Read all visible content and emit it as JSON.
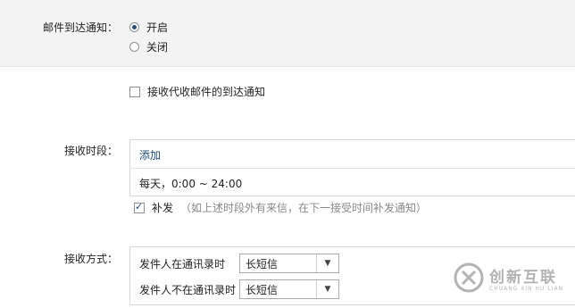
{
  "notify": {
    "label": "邮件到达通知：",
    "on_label": "开启",
    "off_label": "关闭",
    "selected": "on"
  },
  "proxy": {
    "label": "接收代收邮件的到达通知",
    "checked": false
  },
  "period": {
    "label": "接收时段：",
    "add_label": "添加",
    "time_text": "每天，0:00 ~ 24:00",
    "resend_label": "补发",
    "resend_checked": true,
    "resend_hint": "（如上述时段外有来信，在下一接受时间补发通知）"
  },
  "method": {
    "label": "接收方式：",
    "rows": [
      {
        "label": "发件人在通讯录时",
        "value": "长短信"
      },
      {
        "label": "发件人不在通讯录时",
        "value": "长短信"
      }
    ]
  },
  "watermark": {
    "text": "创新互联",
    "sub": "CHUANG XIN HU LIAN"
  }
}
